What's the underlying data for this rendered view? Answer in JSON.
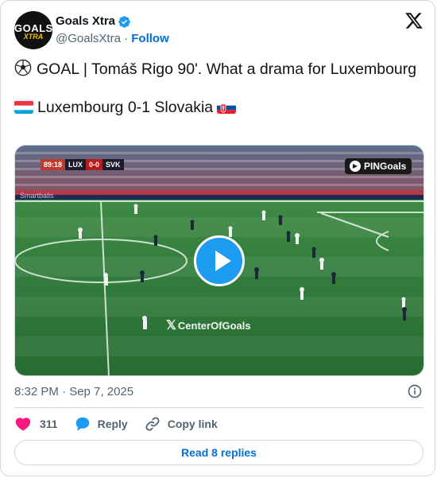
{
  "author": {
    "avatar_text_top": "GOALS",
    "avatar_text_bottom": "XTRA",
    "name": "Goals Xtra",
    "handle": "@GoalsXtra",
    "separator": "·",
    "follow_label": "Follow",
    "verified": true
  },
  "tweet": {
    "line1": "GOAL | Tomáš Rigo 90'. What a drama for Luxembourg",
    "line2": "Luxembourg 0-1 Slovakia",
    "leading_emoji": "soccer-ball-icon",
    "line2_flags": [
      "luxembourg-flag",
      "slovakia-flag"
    ]
  },
  "media": {
    "type": "video",
    "scoreboard": {
      "clock": "89:18",
      "home": "LUX",
      "score": "0-0",
      "away": "SVK"
    },
    "source_badge": "PINGoals",
    "watermark": "CenterOfGoals",
    "ad_board": "Smartbalis"
  },
  "meta": {
    "timestamp": "8:32 PM · Sep 7, 2025"
  },
  "actions": {
    "like_count": "311",
    "reply_label": "Reply",
    "copy_label": "Copy link"
  },
  "footer": {
    "read_replies_label": "Read 8 replies"
  },
  "colors": {
    "accent": "#1d9bf0",
    "link": "#006fd6",
    "like": "#f91880",
    "pitch": "#2f7a3b",
    "secondary_text": "#536471"
  }
}
